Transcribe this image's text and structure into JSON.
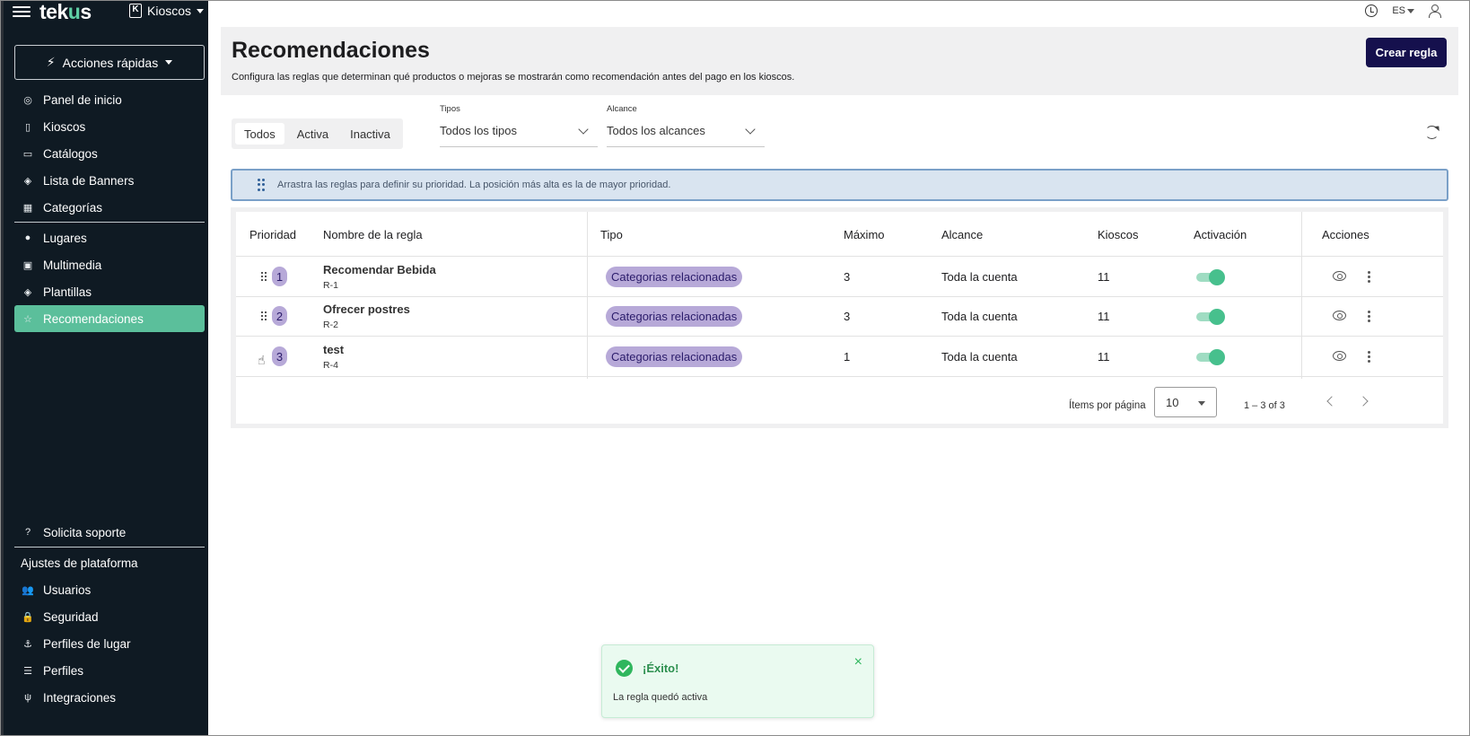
{
  "sidebar": {
    "logo_prefix": "tek",
    "logo_u": "u",
    "logo_suffix": "s",
    "kiosk_badge": "K",
    "kiosk_selector": "Kioscos",
    "quick_actions": "Acciones rápidas",
    "items": [
      {
        "label": "Panel de inicio",
        "icon": "dashboard-icon"
      },
      {
        "label": "Kioscos",
        "icon": "kiosk-icon"
      },
      {
        "label": "Catálogos",
        "icon": "book-icon"
      },
      {
        "label": "Lista de Banners",
        "icon": "layers-icon"
      },
      {
        "label": "Categorías",
        "icon": "categories-icon"
      },
      {
        "label": "Lugares",
        "icon": "location-pin-icon"
      },
      {
        "label": "Multimedia",
        "icon": "image-icon"
      },
      {
        "label": "Plantillas",
        "icon": "layers-icon"
      },
      {
        "label": "Recomendaciones",
        "icon": "star-icon",
        "active": true
      }
    ],
    "bottom_items": [
      {
        "label": "Solicita soporte",
        "icon": "help-icon"
      }
    ],
    "platform_settings_label": "Ajustes de plataforma",
    "platform_items": [
      {
        "label": "Usuarios",
        "icon": "users-icon"
      },
      {
        "label": "Seguridad",
        "icon": "lock-icon"
      },
      {
        "label": "Perfiles de lugar",
        "icon": "anchor-icon"
      },
      {
        "label": "Perfiles",
        "icon": "profiles-icon"
      },
      {
        "label": "Integraciones",
        "icon": "plug-icon"
      }
    ],
    "active_color": "#5bbf9b",
    "bg_color": "#0f1a23"
  },
  "topbar": {
    "language": "ES"
  },
  "header": {
    "title": "Recomendaciones",
    "subtitle": "Configura las reglas que determinan qué productos o mejoras se mostrarán como recomendación antes del pago en los kioscos.",
    "create_button": "Crear regla"
  },
  "filters": {
    "status_tabs": [
      "Todos",
      "Activa",
      "Inactiva"
    ],
    "selected_tab": "Todos",
    "types_label": "Tipos",
    "types_value": "Todos los tipos",
    "scope_label": "Alcance",
    "scope_value": "Todos los alcances"
  },
  "info_banner": "Arrastra las reglas para definir su prioridad. La posición más alta es la de mayor prioridad.",
  "table": {
    "headers": {
      "priority": "Prioridad",
      "name": "Nombre de la regla",
      "type": "Tipo",
      "max": "Máximo",
      "scope": "Alcance",
      "kiosks": "Kioscos",
      "activation": "Activación",
      "actions": "Acciones"
    },
    "rows": [
      {
        "priority": "1",
        "name": "Recomendar Bebida",
        "code": "R-1",
        "type": "Categorias relacionadas",
        "max": "3",
        "scope": "Toda la cuenta",
        "kiosks": "11",
        "active": true
      },
      {
        "priority": "2",
        "name": "Ofrecer postres",
        "code": "R-2",
        "type": "Categorias relacionadas",
        "max": "3",
        "scope": "Toda la cuenta",
        "kiosks": "11",
        "active": true
      },
      {
        "priority": "3",
        "name": "test",
        "code": "R-4",
        "type": "Categorias relacionadas",
        "max": "1",
        "scope": "Toda la cuenta",
        "kiosks": "11",
        "active": true
      }
    ],
    "chip_color": "#b7a9d8",
    "toggle_color": "#47c08d"
  },
  "pagination": {
    "items_per_page_label": "Ítems por página",
    "items_per_page": "10",
    "range": "1 – 3 of 3"
  },
  "toast": {
    "title": "¡Éxito!",
    "message": "La regla quedó activa",
    "close": "×",
    "color": "#2fb65d"
  }
}
